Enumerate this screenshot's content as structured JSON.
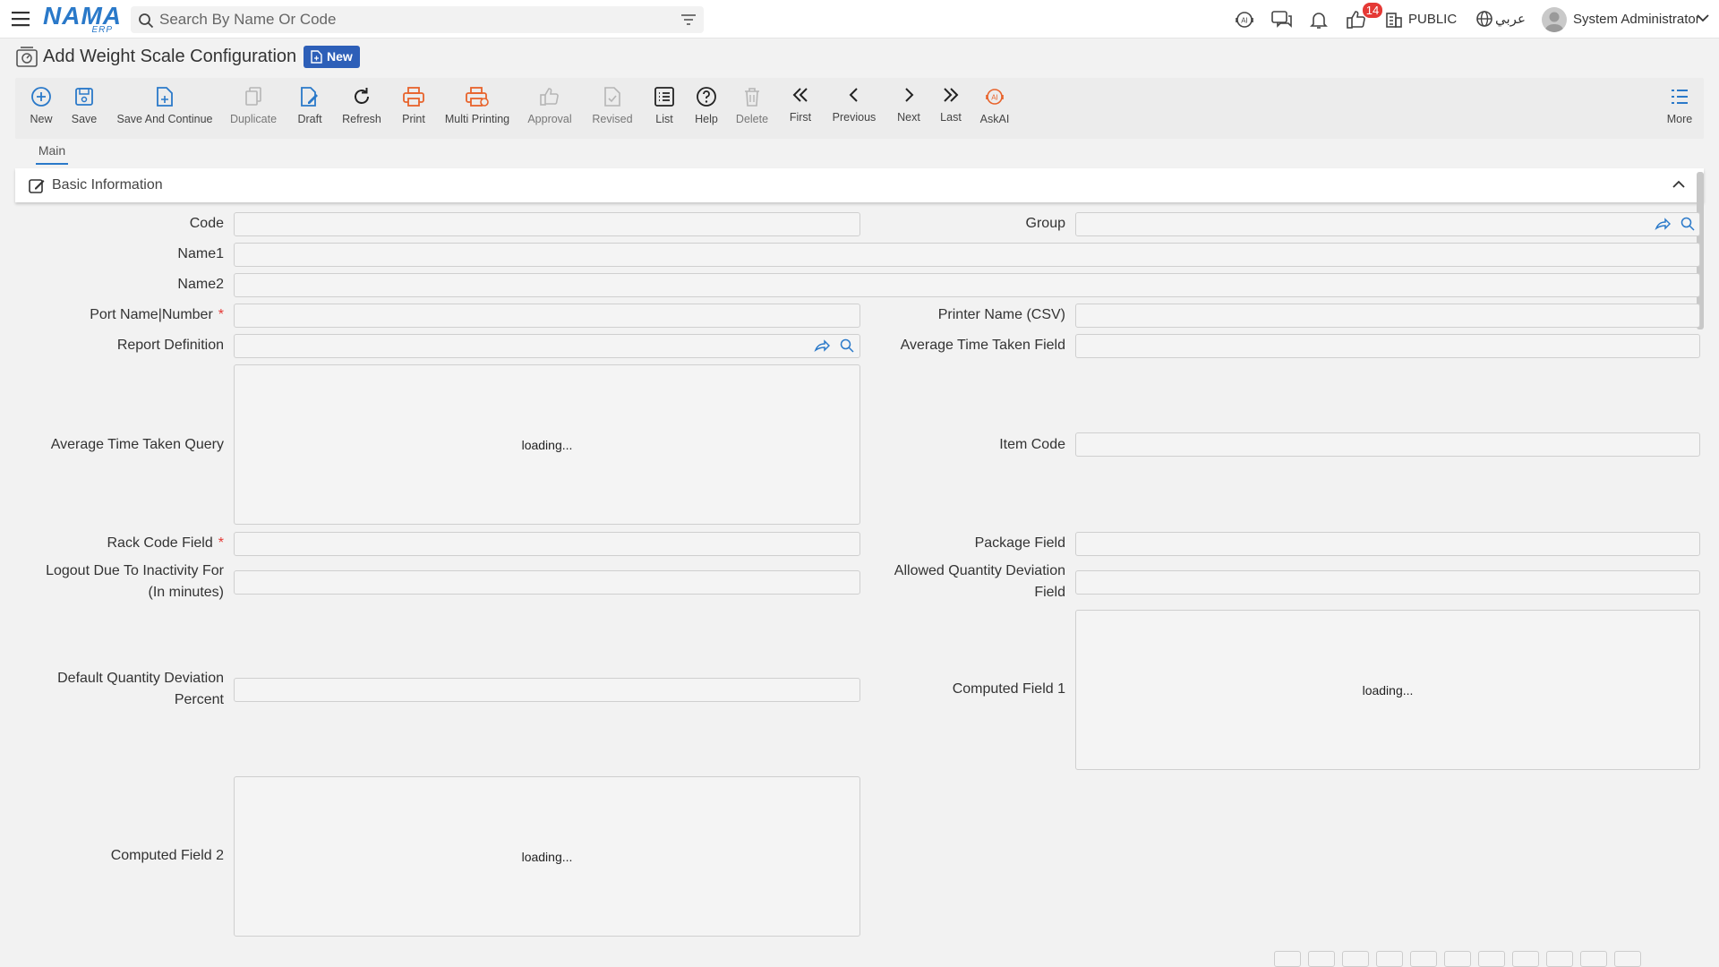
{
  "topbar": {
    "logo_main": "NAMA",
    "logo_sub": "ERP",
    "search_placeholder": "Search By Name Or Code",
    "notification_count": "14",
    "branch_label": "PUBLIC",
    "language_label": "عربي",
    "user_name": "System Administrator"
  },
  "page": {
    "title": "Add Weight Scale Configuration",
    "status_badge": "New"
  },
  "toolbar": {
    "new": "New",
    "save": "Save",
    "save_and_continue": "Save And Continue",
    "duplicate": "Duplicate",
    "draft": "Draft",
    "refresh": "Refresh",
    "print": "Print",
    "multi_printing": "Multi Printing",
    "approval": "Approval",
    "revised": "Revised",
    "list": "List",
    "help": "Help",
    "delete": "Delete",
    "first": "First",
    "previous": "Previous",
    "next": "Next",
    "last": "Last",
    "askai": "AskAI",
    "more": "More",
    "colors": {
      "primary": "#2a79c9",
      "print": "#e8632b",
      "disabled": "#b5b5b5"
    }
  },
  "tabs": {
    "main": "Main"
  },
  "section": {
    "basic_information": "Basic Information"
  },
  "form": {
    "code": "Code",
    "group": "Group",
    "name1": "Name1",
    "name2": "Name2",
    "port_name_number": "Port Name|Number",
    "printer_name_csv": "Printer Name (CSV)",
    "report_definition": "Report Definition",
    "average_time_taken_field": "Average Time Taken Field",
    "average_time_taken_query": "Average Time Taken Query",
    "item_code": "Item Code",
    "rack_code_field": "Rack Code Field",
    "package_field": "Package Field",
    "logout_inactivity_line1": "Logout Due To Inactivity For",
    "logout_inactivity_line2": "(In minutes)",
    "allowed_qty_deviation_line1": "Allowed Quantity Deviation",
    "allowed_qty_deviation_line2": "Field",
    "default_qty_deviation_line1": "Default Quantity Deviation",
    "default_qty_deviation_line2": "Percent",
    "computed_field_1": "Computed Field 1",
    "computed_field_2": "Computed Field 2",
    "required_mark": "*",
    "loading_text": "loading..."
  }
}
